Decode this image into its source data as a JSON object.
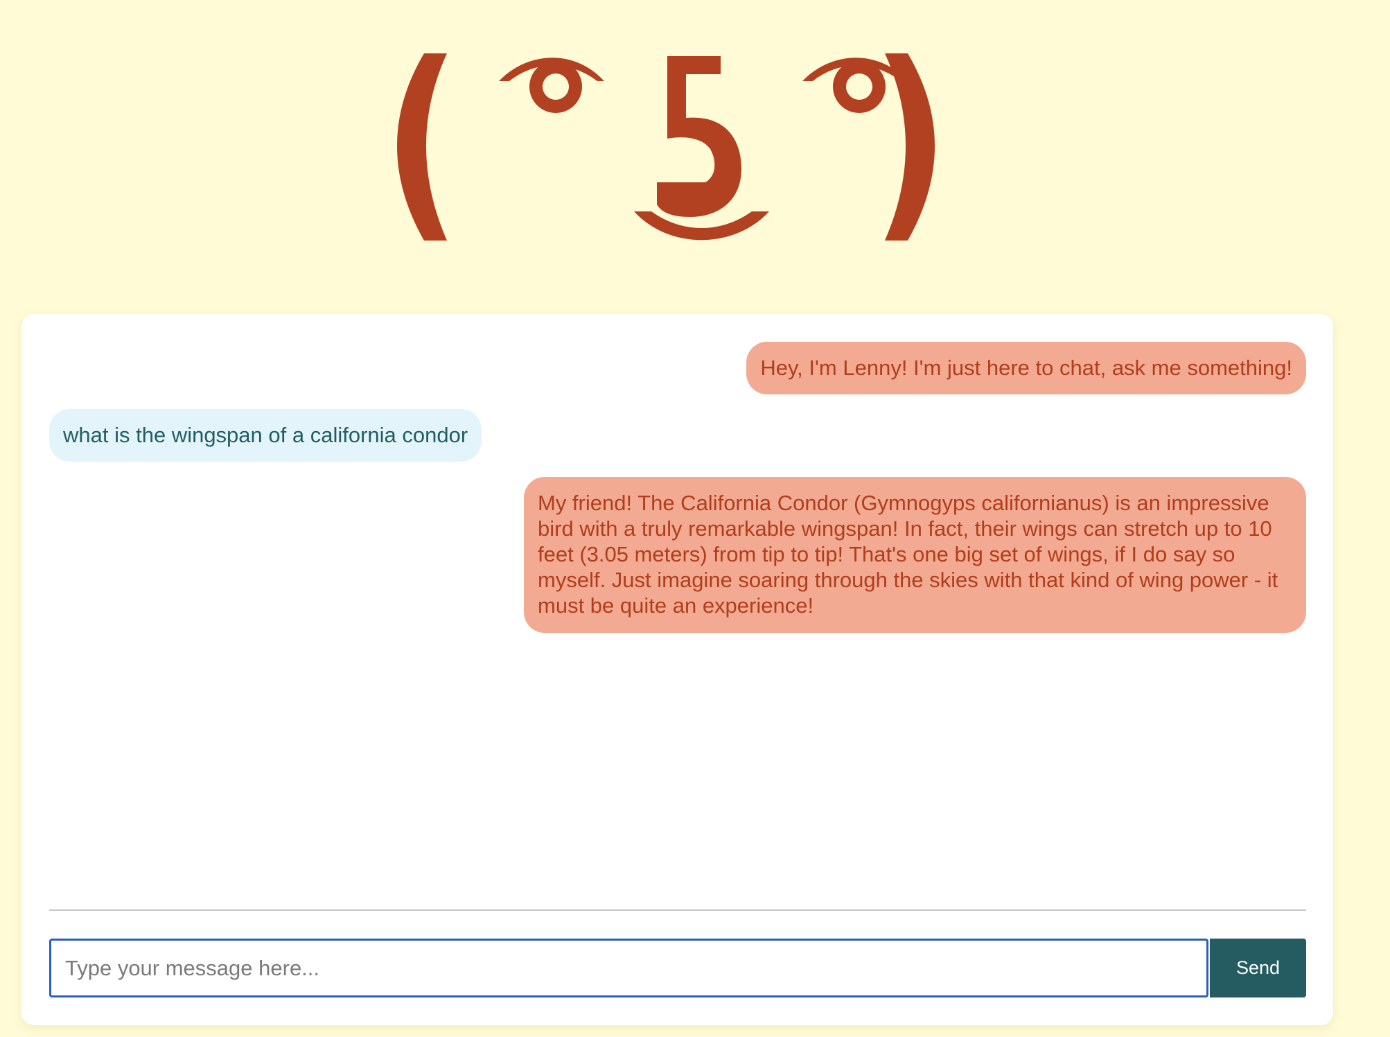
{
  "logo": {
    "alt": "( ͡° ͜ʖ ͡°)",
    "color": "#b24122"
  },
  "colors": {
    "background": "#fffbd6",
    "bot_bubble": "#f2ab92",
    "bot_text": "#b23d1c",
    "user_bubble": "#e3f4fa",
    "user_text": "#215e63",
    "send_button": "#255c62"
  },
  "messages": [
    {
      "role": "bot",
      "text": "Hey, I'm Lenny! I'm just here to chat, ask me something!"
    },
    {
      "role": "user",
      "text": "what is the wingspan of a california condor"
    },
    {
      "role": "bot",
      "text": "My friend! The California Condor (Gymnogyps californianus) is an impressive bird with a truly remarkable wingspan! In fact, their wings can stretch up to 10 feet (3.05 meters) from tip to tip! That's one big set of wings, if I do say so myself. Just imagine soaring through the skies with that kind of wing power - it must be quite an experience!"
    }
  ],
  "composer": {
    "placeholder": "Type your message here...",
    "value": "",
    "send_label": "Send"
  }
}
